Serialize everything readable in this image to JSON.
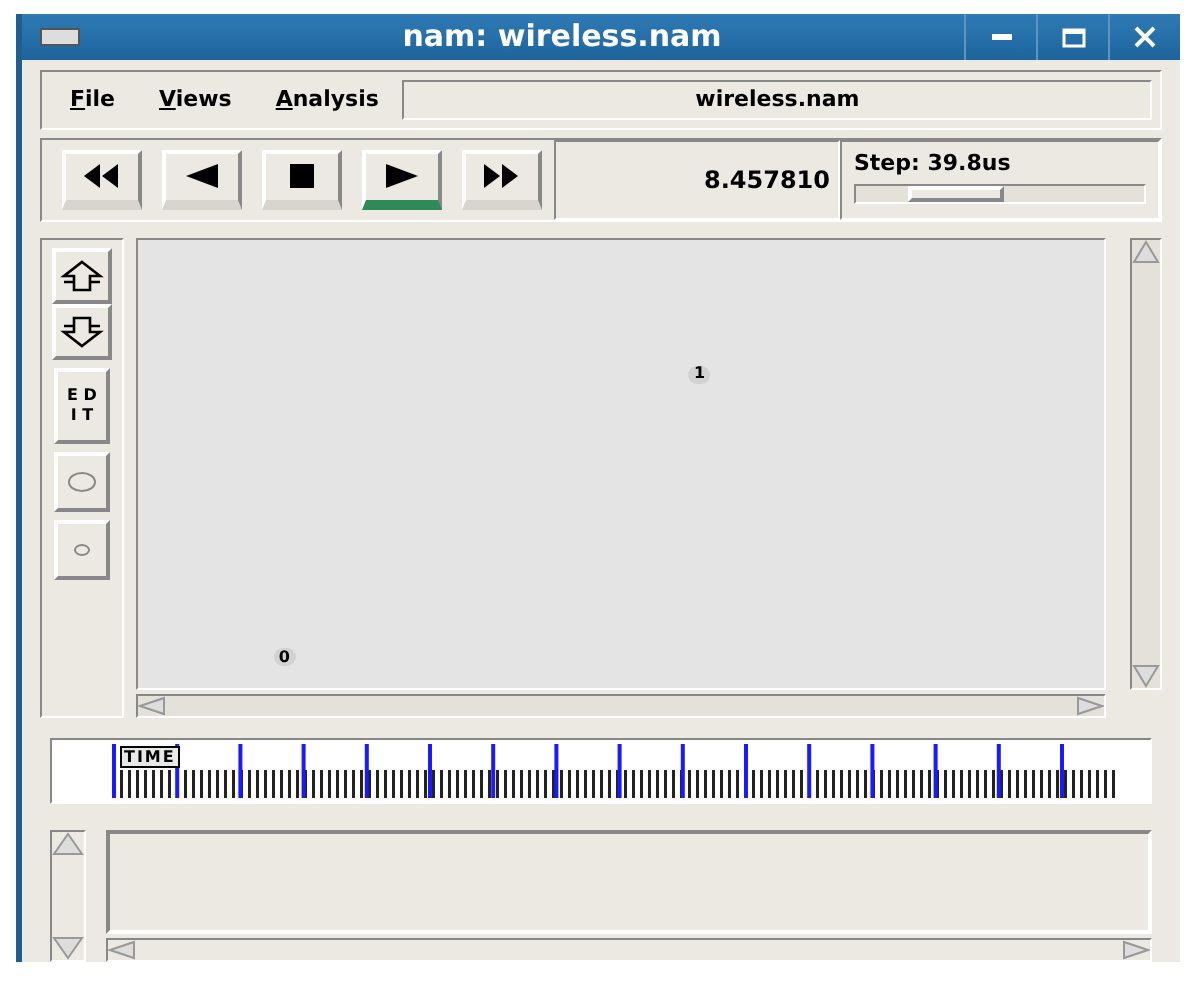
{
  "window": {
    "title": "nam: wireless.nam"
  },
  "menus": [
    {
      "label": "File"
    },
    {
      "label": "Views"
    },
    {
      "label": "Analysis"
    }
  ],
  "file_field": {
    "value": "wireless.nam"
  },
  "playback": [
    {
      "kind": "rewind",
      "selected": false
    },
    {
      "kind": "back",
      "selected": false
    },
    {
      "kind": "stop",
      "selected": false
    },
    {
      "kind": "play",
      "selected": true
    },
    {
      "kind": "forward",
      "selected": false
    }
  ],
  "time": "8.457810",
  "step": {
    "label": "Step: 39.8us",
    "level": 0.35
  },
  "tools": [
    {
      "kind": "zoom-in"
    },
    {
      "kind": "zoom-out"
    },
    {
      "kind": "edit",
      "lines": [
        "E D",
        "I T"
      ]
    },
    {
      "kind": "big-circle"
    },
    {
      "kind": "small-circle"
    }
  ],
  "nodes": [
    {
      "label": "1"
    },
    {
      "label": "0"
    }
  ],
  "timeline": {
    "label": "TIME"
  }
}
